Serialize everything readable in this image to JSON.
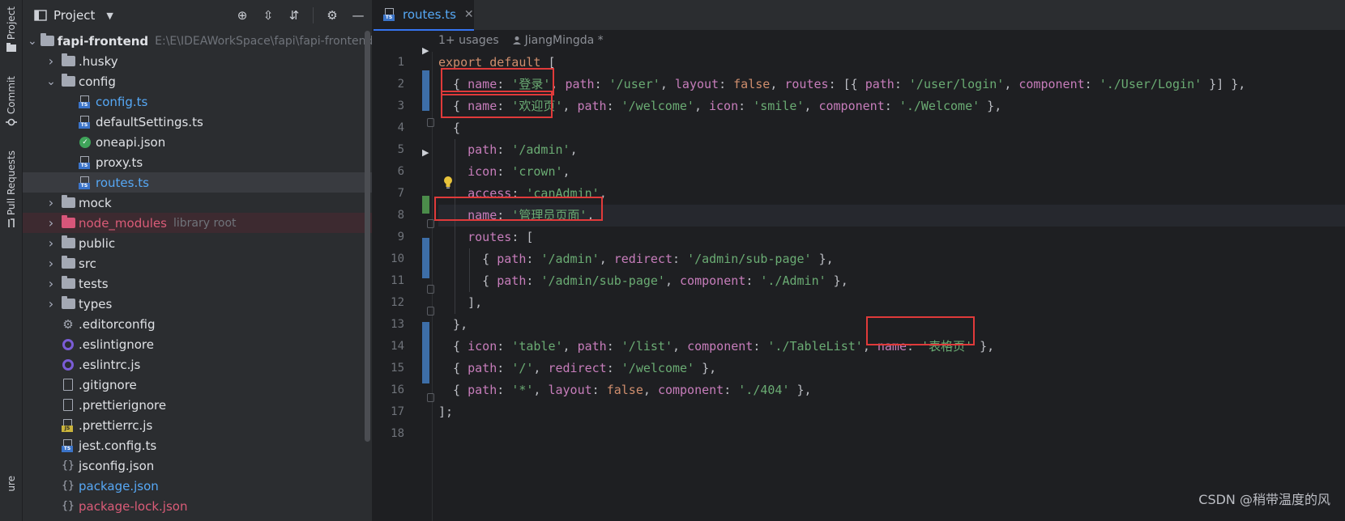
{
  "toolstrip": {
    "project": "Project",
    "commit": "Commit",
    "pull_requests": "Pull Requests",
    "bottom": "ure"
  },
  "project_panel": {
    "title": "Project",
    "tree": [
      {
        "label": "fapi-frontend",
        "hint": "E:\\E\\IDEAWorkSpace\\fapi\\fapi-frontend",
        "type": "folder",
        "depth": 0,
        "expanded": true,
        "bold": true
      },
      {
        "label": ".husky",
        "type": "folder",
        "depth": 1,
        "expanded": false
      },
      {
        "label": "config",
        "type": "folder",
        "depth": 1,
        "expanded": true
      },
      {
        "label": "config.ts",
        "type": "ts",
        "depth": 2,
        "color": "blue"
      },
      {
        "label": "defaultSettings.ts",
        "type": "ts",
        "depth": 2
      },
      {
        "label": "oneapi.json",
        "type": "jsonapi",
        "depth": 2
      },
      {
        "label": "proxy.ts",
        "type": "ts",
        "depth": 2
      },
      {
        "label": "routes.ts",
        "type": "ts",
        "depth": 2,
        "color": "blue",
        "selected": true
      },
      {
        "label": "mock",
        "type": "folder",
        "depth": 1,
        "expanded": false
      },
      {
        "label": "node_modules",
        "hint": "library root",
        "type": "folder-lib",
        "depth": 1,
        "expanded": false,
        "color": "red"
      },
      {
        "label": "public",
        "type": "folder",
        "depth": 1,
        "expanded": false
      },
      {
        "label": "src",
        "type": "folder",
        "depth": 1,
        "expanded": false
      },
      {
        "label": "tests",
        "type": "folder",
        "depth": 1,
        "expanded": false
      },
      {
        "label": "types",
        "type": "folder",
        "depth": 1,
        "expanded": false
      },
      {
        "label": ".editorconfig",
        "type": "gear",
        "depth": 1
      },
      {
        "label": ".eslintignore",
        "type": "ring",
        "depth": 1
      },
      {
        "label": ".eslintrc.js",
        "type": "ring",
        "depth": 1
      },
      {
        "label": ".gitignore",
        "type": "file",
        "depth": 1
      },
      {
        "label": ".prettierignore",
        "type": "file",
        "depth": 1
      },
      {
        "label": ".prettierrc.js",
        "type": "js",
        "depth": 1
      },
      {
        "label": "jest.config.ts",
        "type": "ts",
        "depth": 1
      },
      {
        "label": "jsconfig.json",
        "type": "json",
        "depth": 1
      },
      {
        "label": "package.json",
        "type": "json",
        "depth": 1,
        "color": "blue"
      },
      {
        "label": "package-lock.json",
        "type": "json",
        "depth": 1,
        "color": "red"
      }
    ]
  },
  "editor": {
    "tab_name": "routes.ts",
    "usages": "1+ usages",
    "author": "JiangMingda *",
    "line_numbers": [
      "1",
      "2",
      "3",
      "4",
      "5",
      "6",
      "7",
      "8",
      "9",
      "10",
      "11",
      "12",
      "13",
      "14",
      "15",
      "16",
      "17",
      "18"
    ],
    "lines": [
      [
        [
          "kw",
          "export default "
        ],
        [
          "pun",
          "["
        ]
      ],
      [
        [
          "pun",
          "  { "
        ],
        [
          "prop",
          "name"
        ],
        [
          "pun",
          ": "
        ],
        [
          "str",
          "'登录'"
        ],
        [
          "pun",
          ", "
        ],
        [
          "prop",
          "path"
        ],
        [
          "pun",
          ": "
        ],
        [
          "str",
          "'/user'"
        ],
        [
          "pun",
          ", "
        ],
        [
          "prop",
          "layout"
        ],
        [
          "pun",
          ": "
        ],
        [
          "kw",
          "false"
        ],
        [
          "pun",
          ", "
        ],
        [
          "prop",
          "routes"
        ],
        [
          "pun",
          ": [{ "
        ],
        [
          "prop",
          "path"
        ],
        [
          "pun",
          ": "
        ],
        [
          "str",
          "'/user/login'"
        ],
        [
          "pun",
          ", "
        ],
        [
          "prop",
          "component"
        ],
        [
          "pun",
          ": "
        ],
        [
          "str",
          "'./User/Login'"
        ],
        [
          "pun",
          " }] },"
        ]
      ],
      [
        [
          "pun",
          "  { "
        ],
        [
          "prop",
          "name"
        ],
        [
          "pun",
          ": "
        ],
        [
          "str",
          "'欢迎页'"
        ],
        [
          "pun",
          ", "
        ],
        [
          "prop",
          "path"
        ],
        [
          "pun",
          ": "
        ],
        [
          "str",
          "'/welcome'"
        ],
        [
          "pun",
          ", "
        ],
        [
          "prop",
          "icon"
        ],
        [
          "pun",
          ": "
        ],
        [
          "str",
          "'smile'"
        ],
        [
          "pun",
          ", "
        ],
        [
          "prop",
          "component"
        ],
        [
          "pun",
          ": "
        ],
        [
          "str",
          "'./Welcome'"
        ],
        [
          "pun",
          " },"
        ]
      ],
      [
        [
          "pun",
          "  {"
        ]
      ],
      [
        [
          "pun",
          "    "
        ],
        [
          "prop",
          "path"
        ],
        [
          "pun",
          ": "
        ],
        [
          "str",
          "'/admin'"
        ],
        [
          "pun",
          ","
        ]
      ],
      [
        [
          "pun",
          "    "
        ],
        [
          "prop",
          "icon"
        ],
        [
          "pun",
          ": "
        ],
        [
          "str",
          "'crown'"
        ],
        [
          "pun",
          ","
        ]
      ],
      [
        [
          "pun",
          "    "
        ],
        [
          "prop",
          "access"
        ],
        [
          "pun",
          ": "
        ],
        [
          "str",
          "'canAdmin'"
        ],
        [
          "pun",
          ","
        ]
      ],
      [
        [
          "pun",
          "    "
        ],
        [
          "prop",
          "name"
        ],
        [
          "pun",
          ": "
        ],
        [
          "str",
          "'管理员页面'"
        ],
        [
          "pun",
          ","
        ]
      ],
      [
        [
          "pun",
          "    "
        ],
        [
          "prop",
          "routes"
        ],
        [
          "pun",
          ": ["
        ]
      ],
      [
        [
          "pun",
          "      { "
        ],
        [
          "prop",
          "path"
        ],
        [
          "pun",
          ": "
        ],
        [
          "str",
          "'/admin'"
        ],
        [
          "pun",
          ", "
        ],
        [
          "prop",
          "redirect"
        ],
        [
          "pun",
          ": "
        ],
        [
          "str",
          "'/admin/sub-page'"
        ],
        [
          "pun",
          " },"
        ]
      ],
      [
        [
          "pun",
          "      { "
        ],
        [
          "prop",
          "path"
        ],
        [
          "pun",
          ": "
        ],
        [
          "str",
          "'/admin/sub-page'"
        ],
        [
          "pun",
          ", "
        ],
        [
          "prop",
          "component"
        ],
        [
          "pun",
          ": "
        ],
        [
          "str",
          "'./Admin'"
        ],
        [
          "pun",
          " },"
        ]
      ],
      [
        [
          "pun",
          "    ],"
        ]
      ],
      [
        [
          "pun",
          "  },"
        ]
      ],
      [
        [
          "pun",
          "  { "
        ],
        [
          "prop",
          "icon"
        ],
        [
          "pun",
          ": "
        ],
        [
          "str",
          "'table'"
        ],
        [
          "pun",
          ", "
        ],
        [
          "prop",
          "path"
        ],
        [
          "pun",
          ": "
        ],
        [
          "str",
          "'/list'"
        ],
        [
          "pun",
          ", "
        ],
        [
          "prop",
          "component"
        ],
        [
          "pun",
          ": "
        ],
        [
          "str",
          "'./TableList'"
        ],
        [
          "pun",
          ", "
        ],
        [
          "prop",
          "name"
        ],
        [
          "pun",
          ": "
        ],
        [
          "str",
          "'表格页'"
        ],
        [
          "pun",
          " },"
        ]
      ],
      [
        [
          "pun",
          "  { "
        ],
        [
          "prop",
          "path"
        ],
        [
          "pun",
          ": "
        ],
        [
          "str",
          "'/'"
        ],
        [
          "pun",
          ", "
        ],
        [
          "prop",
          "redirect"
        ],
        [
          "pun",
          ": "
        ],
        [
          "str",
          "'/welcome'"
        ],
        [
          "pun",
          " },"
        ]
      ],
      [
        [
          "pun",
          "  { "
        ],
        [
          "prop",
          "path"
        ],
        [
          "pun",
          ": "
        ],
        [
          "str",
          "'*'"
        ],
        [
          "pun",
          ", "
        ],
        [
          "prop",
          "layout"
        ],
        [
          "pun",
          ": "
        ],
        [
          "kw",
          "false"
        ],
        [
          "pun",
          ", "
        ],
        [
          "prop",
          "component"
        ],
        [
          "pun",
          ": "
        ],
        [
          "str",
          "'./404'"
        ],
        [
          "pun",
          " },"
        ]
      ],
      [
        [
          "pun",
          "];"
        ]
      ],
      [
        [
          "pun",
          ""
        ]
      ]
    ]
  },
  "watermark": "CSDN @稍带温度的风",
  "colors": {
    "accent": "#3574f0",
    "keyword": "#cf8e6d",
    "property": "#c77dbb",
    "string": "#6aab73",
    "highlight_box": "#e03a3a"
  }
}
